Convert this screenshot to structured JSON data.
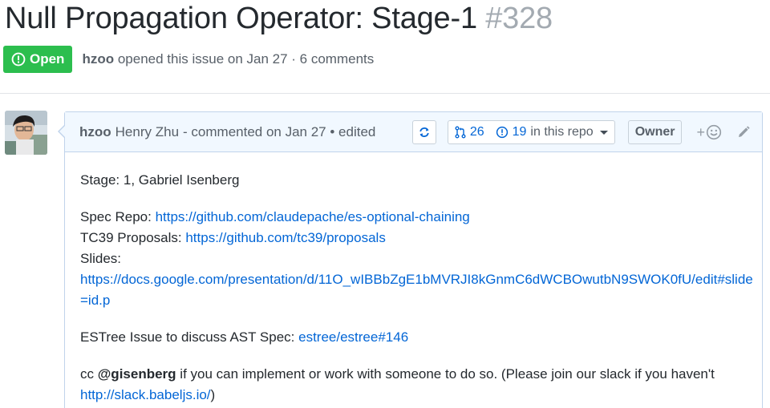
{
  "issue": {
    "title": "Null Propagation Operator: Stage-1",
    "number": "#328",
    "state": "Open",
    "author": "hzoo",
    "opened_text": "opened this issue on Jan 27 · 6 comments"
  },
  "comment": {
    "author": "hzoo",
    "full_name": "Henry Zhu",
    "meta": "- commented on Jan 27 • edited",
    "stats": {
      "prs": "26",
      "issues": "19",
      "scope_label": "in this repo"
    },
    "role_badge": "Owner",
    "reaction_plus": "+",
    "body": {
      "stage_line": "Stage: 1, Gabriel Isenberg",
      "spec_repo_label": "Spec Repo: ",
      "spec_repo_url": "https://github.com/claudepache/es-optional-chaining",
      "tc39_label": "TC39 Proposals: ",
      "tc39_url": "https://github.com/tc39/proposals",
      "slides_label": "Slides:",
      "slides_url": "https://docs.google.com/presentation/d/11O_wIBBbZgE1bMVRJI8kGnmC6dWCBOwutbN9SWOK0fU/edit#slide=id.p",
      "estree_label": "ESTree Issue to discuss AST Spec: ",
      "estree_link": "estree/estree#146",
      "cc_prefix": "cc ",
      "cc_mention": "@gisenberg",
      "cc_text": " if you can implement or work with someone to do so. (Please join our slack if you haven't ",
      "slack_url": "http://slack.babeljs.io/",
      "cc_suffix": ")"
    }
  },
  "colors": {
    "open_green": "#2cbe4e",
    "link_blue": "#0366d6",
    "header_bg": "#f1f8ff",
    "border_blue": "#c0d3eb"
  }
}
